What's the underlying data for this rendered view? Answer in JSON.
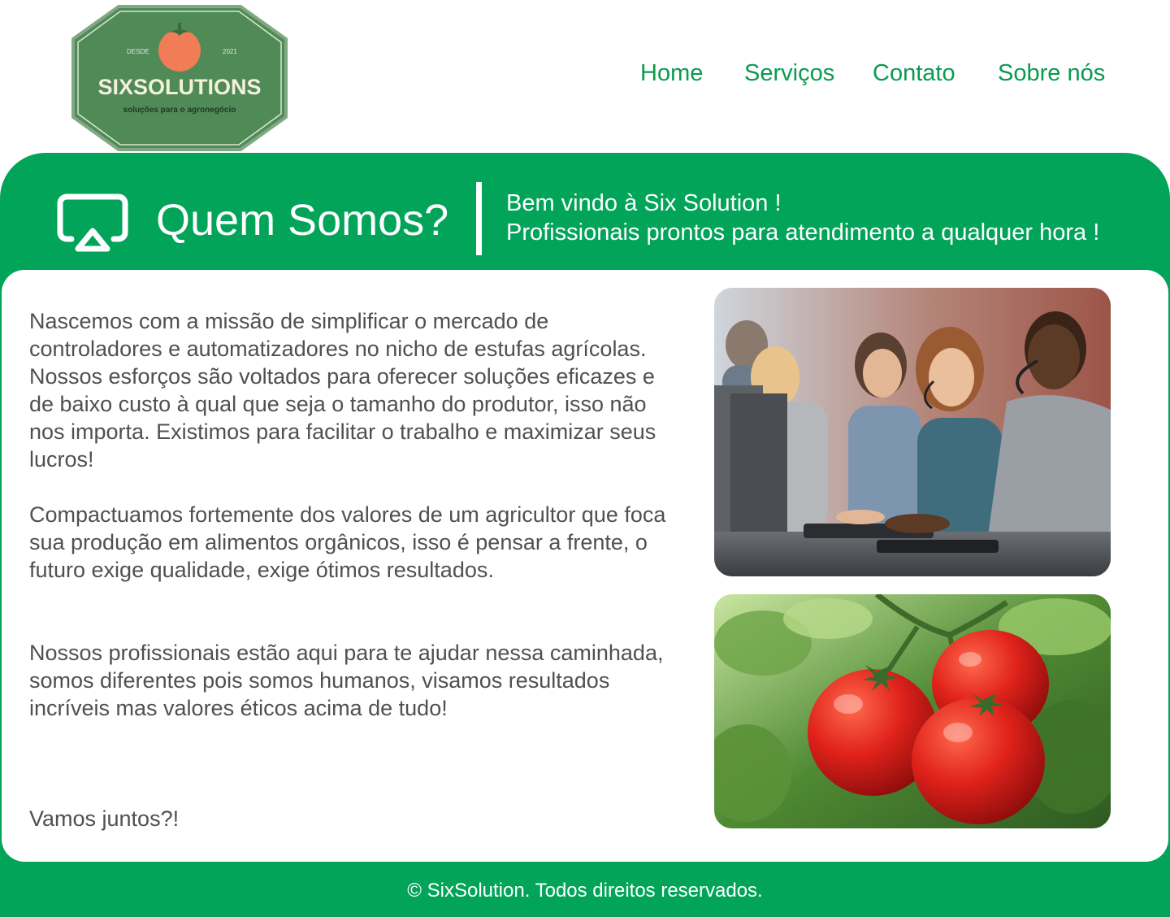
{
  "brand": {
    "name": "SIXSOLUTIONS",
    "tagline": "soluções para o agronegócio",
    "since_label": "DESDE",
    "since_year": "2021",
    "colors": {
      "primary_green": "#02a45a",
      "logo_green": "#4f8a57",
      "nav_green": "#0a9a50",
      "tomato": "#f07d55"
    }
  },
  "nav": {
    "items": [
      {
        "label": "Home"
      },
      {
        "label": "Serviços"
      },
      {
        "label": "Contato"
      },
      {
        "label": "Sobre nós"
      }
    ]
  },
  "hero": {
    "icon": "airplay-icon",
    "title": "Quem Somos?",
    "subtitle_line1": "Bem vindo à Six Solution !",
    "subtitle_line2": "Profissionais prontos para atendimento a qualquer hora !"
  },
  "content": {
    "paragraphs": [
      "Nascemos com a missão de simplificar o mercado de controladores e automatizadores no nicho de estufas agrícolas. Nossos esforços são voltados para oferecer soluções eficazes e de baixo custo à qual que seja o tamanho do produtor, isso não nos importa. Existimos para facilitar o trabalho e maximizar seus lucros!",
      "Compactuamos fortemente dos valores de um agricultor que foca sua produção em alimentos orgânicos, isso é pensar a frente, o futuro exige qualidade, exige ótimos resultados.",
      "Nossos profissionais estão aqui para te ajudar nessa caminhada, somos diferentes pois somos humanos, visamos resultados incríveis mas valores éticos acima de tudo!",
      "Vamos juntos?!"
    ],
    "images": [
      {
        "name": "call-center-team-photo"
      },
      {
        "name": "tomatoes-photo"
      }
    ]
  },
  "footer": {
    "copyright": "© SixSolution. Todos direitos reservados."
  }
}
